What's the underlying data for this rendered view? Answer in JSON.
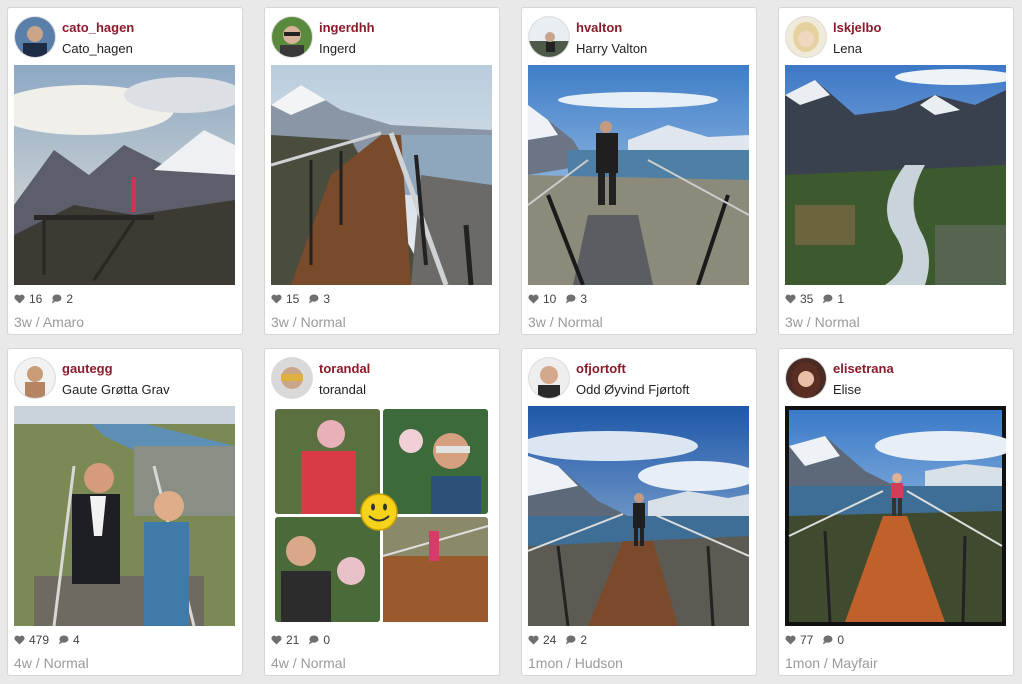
{
  "posts": [
    {
      "username": "cato_hagen",
      "fullname": "Cato_hagen",
      "likes": "16",
      "comments": "2",
      "age": "3w",
      "filter": "Amaro",
      "like_icon": "heart-icon",
      "comment_icon": "speech-bubble-icon"
    },
    {
      "username": "ingerdhh",
      "fullname": "Ingerd",
      "likes": "15",
      "comments": "3",
      "age": "3w",
      "filter": "Normal",
      "like_icon": "heart-icon",
      "comment_icon": "speech-bubble-icon"
    },
    {
      "username": "hvalton",
      "fullname": "Harry Valton",
      "likes": "10",
      "comments": "3",
      "age": "3w",
      "filter": "Normal",
      "like_icon": "heart-icon",
      "comment_icon": "speech-bubble-icon"
    },
    {
      "username": "lskjelbo",
      "fullname": "Lena",
      "likes": "35",
      "comments": "1",
      "age": "3w",
      "filter": "Normal",
      "like_icon": "heart-icon",
      "comment_icon": "speech-bubble-icon"
    },
    {
      "username": "gautegg",
      "fullname": "Gaute Grøtta Grav",
      "likes": "479",
      "comments": "4",
      "age": "4w",
      "filter": "Normal",
      "like_icon": "heart-icon",
      "comment_icon": "speech-bubble-icon"
    },
    {
      "username": "torandal",
      "fullname": "torandal",
      "likes": "21",
      "comments": "0",
      "age": "4w",
      "filter": "Normal",
      "like_icon": "heart-icon",
      "comment_icon": "speech-bubble-icon"
    },
    {
      "username": "ofjortoft",
      "fullname": "Odd Øyvind Fjørtoft",
      "likes": "24",
      "comments": "2",
      "age": "1mon",
      "filter": "Hudson",
      "like_icon": "heart-icon",
      "comment_icon": "speech-bubble-icon"
    },
    {
      "username": "elisetrana",
      "fullname": "Elise",
      "likes": "77",
      "comments": "0",
      "age": "1mon",
      "filter": "Mayfair",
      "like_icon": "heart-icon",
      "comment_icon": "speech-bubble-icon"
    }
  ],
  "meta_separator": " / ",
  "colors": {
    "username": "#8b1a2b",
    "meta": "#9a9a9a",
    "background": "#e9e9e9"
  }
}
